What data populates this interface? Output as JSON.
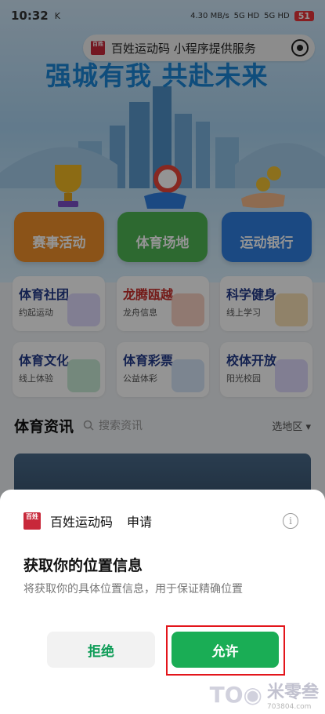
{
  "status_bar": {
    "time": "10:32",
    "indicators": "K",
    "net_speed": "4.30 MB/s",
    "signal_1": "5G HD",
    "signal_2": "5G HD",
    "battery": "51"
  },
  "capsule": {
    "logo_text": "百姓运动码",
    "text": "百姓运动码 小程序提供服务",
    "icon": "target-icon"
  },
  "hero": {
    "slogan": "强城有我 共赴未来"
  },
  "main_cards": [
    {
      "label": "赛事活动",
      "color": "#ef8f2a",
      "icon": "trophy-icon"
    },
    {
      "label": "体育场地",
      "color": "#4fb553",
      "icon": "clock-stadium-icon"
    },
    {
      "label": "运动银行",
      "color": "#2f7ee0",
      "icon": "coin-hand-icon"
    }
  ],
  "grid_items": [
    {
      "title": "体育社团",
      "subtitle": "约起运动",
      "color": "#e6e4fb"
    },
    {
      "title": "龙腾瓯越",
      "subtitle": "龙舟信息",
      "color": "#ffe9e3"
    },
    {
      "title": "科学健身",
      "subtitle": "线上学习",
      "color": "#fff2df"
    },
    {
      "title": "体育文化",
      "subtitle": "线上体验",
      "color": "#e3f4ea"
    },
    {
      "title": "体育彩票",
      "subtitle": "公益体彩",
      "color": "#e7eefb"
    },
    {
      "title": "校体开放",
      "subtitle": "阳光校园",
      "color": "#ece9fb"
    }
  ],
  "news": {
    "title": "体育资讯",
    "search_placeholder": "搜索资讯",
    "region": "选地区"
  },
  "permission_sheet": {
    "app_name": "百姓运动码",
    "request_label": "申请",
    "title": "获取你的位置信息",
    "description": "将获取你的具体位置信息，用于保证精确位置",
    "reject_label": "拒绝",
    "allow_label": "允许"
  },
  "watermark": {
    "text": "米零叁",
    "url": "703804.com"
  }
}
